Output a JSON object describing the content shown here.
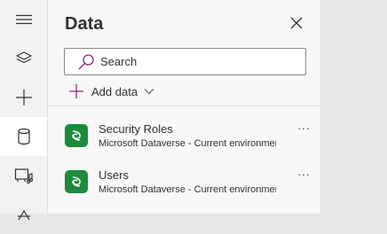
{
  "rail": {
    "items": [
      {
        "icon": "hamburger-menu-icon",
        "active": false
      },
      {
        "icon": "layers-icon",
        "active": false
      },
      {
        "icon": "plus-icon",
        "active": false
      },
      {
        "icon": "database-icon",
        "active": true
      },
      {
        "icon": "media-icon",
        "active": false
      },
      {
        "icon": "advanced-tools-icon",
        "active": false
      }
    ]
  },
  "panel": {
    "title": "Data",
    "search_placeholder": "Search",
    "add_data_label": "Add data",
    "items": [
      {
        "name": "Security Roles",
        "source": "Microsoft Dataverse - Current environment",
        "more": "···"
      },
      {
        "name": "Users",
        "source": "Microsoft Dataverse - Current environment",
        "more": "···"
      }
    ]
  },
  "colors": {
    "accent": "#8a2c7c",
    "dataverse_green": "#1e8a3c",
    "panel_bg": "#f8f8f8",
    "canvas_bg": "#e6e6e6"
  }
}
